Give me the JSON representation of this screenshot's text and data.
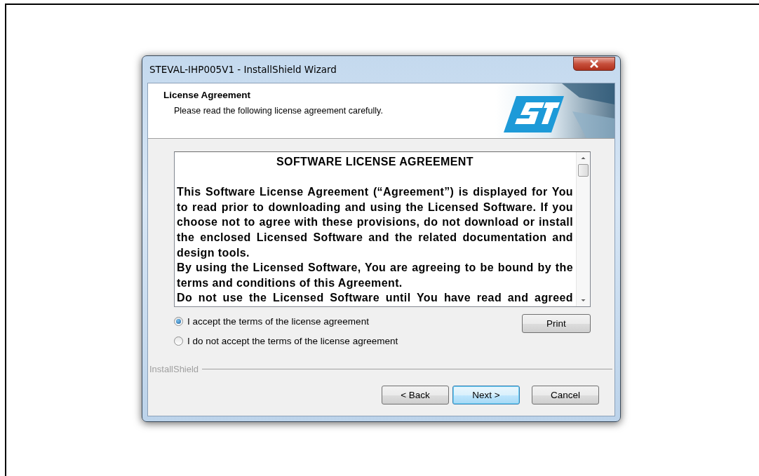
{
  "window": {
    "title": "STEVAL-IHP005V1 - InstallShield Wizard"
  },
  "header": {
    "title": "License Agreement",
    "subtitle": "Please read the following license agreement carefully."
  },
  "license": {
    "heading": "SOFTWARE LICENSE AGREEMENT",
    "paragraphs": [
      {
        "text": "This Software License Agreement (“Agreement”) is displayed for You to read prior to downloading and using the Licensed Software. If you choose not to agree with these provisions, do not download or install the enclosed Licensed Software and the related documentation and design tools.",
        "continues": false
      },
      {
        "text": "By using the Licensed Software, You are agreeing to be bound by the terms and conditions of this Agreement.",
        "continues": false
      },
      {
        "text": "Do not use the Licensed Software until You have read and agreed",
        "continues": true
      }
    ]
  },
  "options": [
    {
      "label": "I accept the terms of the license agreement",
      "selected": true
    },
    {
      "label": "I do not accept the terms of the license agreement",
      "selected": false
    }
  ],
  "print_button": "Print",
  "brand_label": "InstallShield",
  "buttons": [
    {
      "label": "< Back",
      "default": false
    },
    {
      "label": "Next >",
      "default": true
    },
    {
      "label": "Cancel",
      "default": false
    }
  ]
}
